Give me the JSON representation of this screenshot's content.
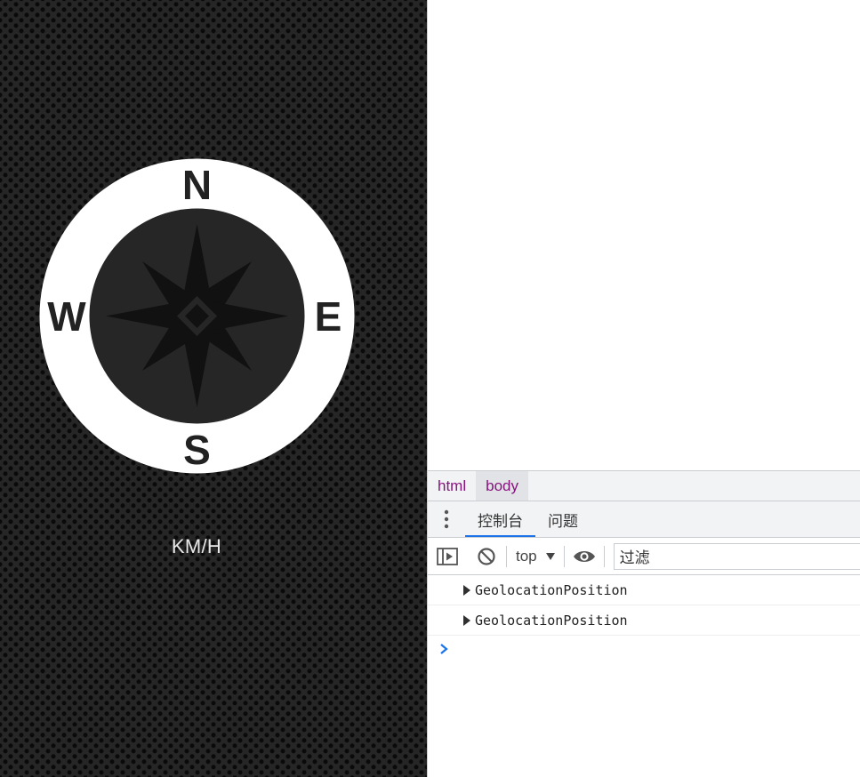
{
  "app": {
    "compass": {
      "north": "N",
      "south": "S",
      "east": "E",
      "west": "W"
    },
    "speed_unit": "KM/H"
  },
  "devtools": {
    "breadcrumbs": [
      "html",
      "body"
    ],
    "tabs": [
      {
        "label": "控制台",
        "active": true
      },
      {
        "label": "问题",
        "active": false
      }
    ],
    "toolbar": {
      "context": "top",
      "filter_placeholder": "过滤"
    },
    "console_logs": [
      "GeolocationPosition",
      "GeolocationPosition"
    ],
    "prompt_symbol": "›"
  },
  "colors": {
    "app_background": "#262626",
    "compass_ring": "#ffffff",
    "compass_rose": "#111111",
    "devtools_accent": "#1a73e8",
    "breadcrumb_text": "#881280",
    "prompt": "#1a73e8"
  }
}
